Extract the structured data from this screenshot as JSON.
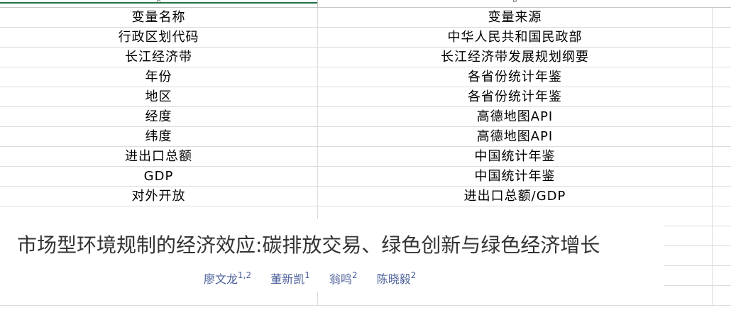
{
  "columns": {
    "a": "A",
    "b": "B"
  },
  "rows": [
    {
      "a": "变量名称",
      "b": "变量来源"
    },
    {
      "a": "行政区划代码",
      "b": "中华人民共和国民政部"
    },
    {
      "a": "长江经济带",
      "b": "长江经济带发展规划纲要"
    },
    {
      "a": "年份",
      "b": "各省份统计年鉴"
    },
    {
      "a": "地区",
      "b": "各省份统计年鉴"
    },
    {
      "a": "经度",
      "b": "高德地图API"
    },
    {
      "a": "纬度",
      "b": "高德地图API"
    },
    {
      "a": "进出口总额",
      "b": "中国统计年鉴"
    },
    {
      "a": "GDP",
      "b": "中国统计年鉴"
    },
    {
      "a": "对外开放",
      "b": "进出口总额/GDP"
    }
  ],
  "paper": {
    "title": "市场型环境规制的经济效应:碳排放交易、绿色创新与绿色经济增长",
    "authors": [
      {
        "name": "廖文龙",
        "sup": "1,2"
      },
      {
        "name": "董新凯",
        "sup": "1"
      },
      {
        "name": "翁鸣",
        "sup": "2"
      },
      {
        "name": "陈晓毅",
        "sup": "2"
      }
    ]
  },
  "colors": {
    "header_accent": "#217346",
    "grid": "#dadcdf",
    "author_link": "#4a5f9a"
  }
}
